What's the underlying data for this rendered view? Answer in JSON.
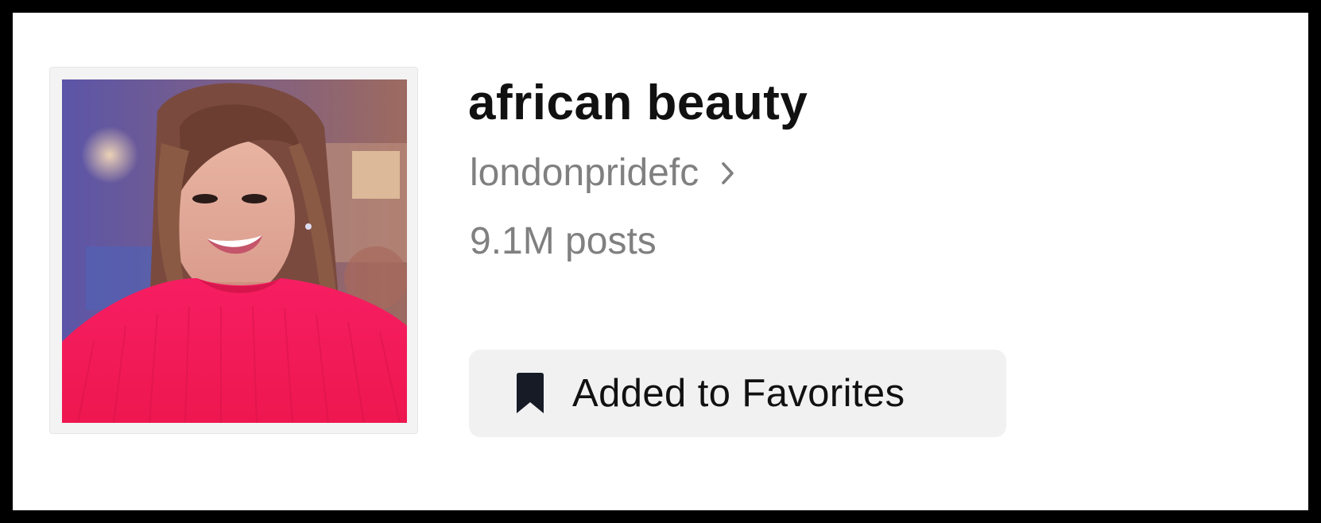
{
  "collection": {
    "title": "african beauty",
    "creator": "londonpridefc",
    "post_count": "9.1M posts"
  },
  "favorite_button": {
    "label": "Added to Favorites",
    "icon": "bookmark-filled-icon"
  },
  "cover": {
    "icon": "collection-cover-photo"
  },
  "colors": {
    "title_text": "#111111",
    "secondary_text": "#808080",
    "button_bg": "#f1f1f2",
    "bookmark_icon": "#161b26",
    "frame_border": "#000000"
  }
}
